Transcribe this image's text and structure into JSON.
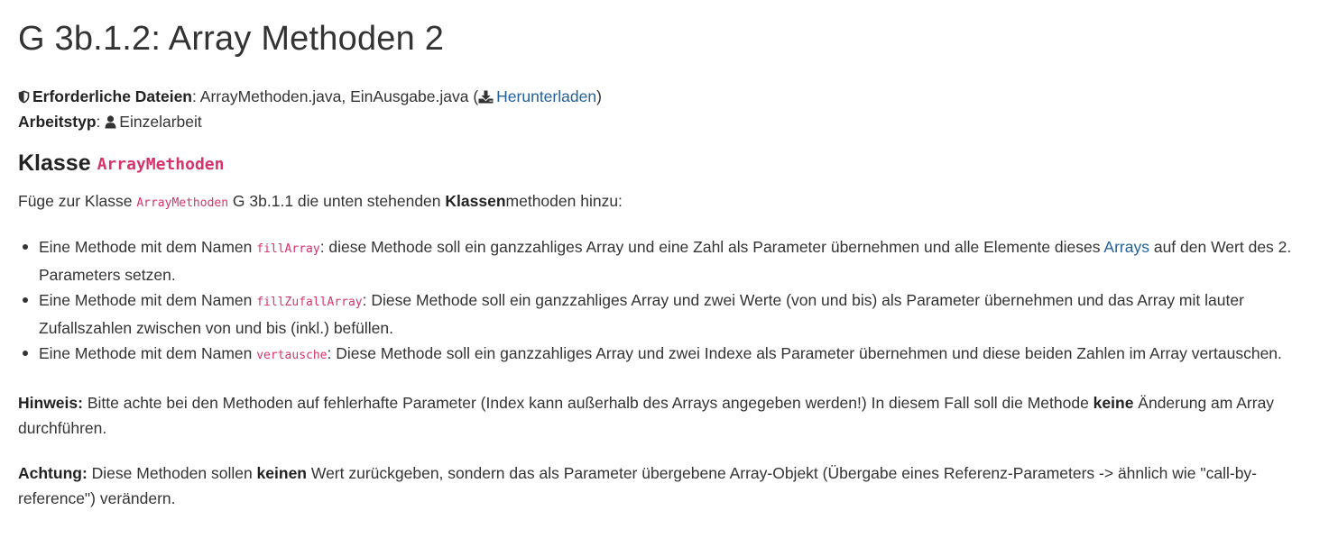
{
  "header": {
    "title": "G 3b.1.2: Array Methoden 2"
  },
  "meta": {
    "files_label": "Erforderliche Dateien",
    "files_colon": ":",
    "files_value": "ArrayMethoden.java, EinAusgabe.java (",
    "download_label": "Herunterladen",
    "files_close": ")",
    "type_label": "Arbeitstyp",
    "type_colon": ":",
    "type_value": "Einzelarbeit"
  },
  "section": {
    "heading": "Klasse",
    "class_name": "ArrayMethoden",
    "intro_before": "Füge zur Klasse ",
    "intro_code": "ArrayMethoden",
    "intro_middle": " G 3b.1.1 die unten stehenden ",
    "intro_bold": "Klassen",
    "intro_after": "methoden hinzu:"
  },
  "methods": [
    {
      "prefix": "Eine Methode mit dem Namen ",
      "name": "fillArray",
      "text_before_link": ": diese Methode soll ein ganzzahliges Array und eine Zahl als Parameter übernehmen und alle Elemente dieses ",
      "link": "Arrays",
      "text_after_link": " auf den Wert des 2. Parameters setzen."
    },
    {
      "prefix": "Eine Methode mit dem Namen ",
      "name": "fillZufallArray",
      "text": ": Diese Methode soll ein ganzzahliges Array und zwei Werte (von und bis) als Parameter übernehmen und das Array mit lauter Zufallszahlen zwischen von und bis (inkl.) befüllen."
    },
    {
      "prefix": "Eine Methode mit dem Namen ",
      "name": "vertausche",
      "text": ": Diese Methode soll ein ganzzahliges Array und zwei Indexe als Parameter übernehmen und diese beiden Zahlen im Array vertauschen."
    }
  ],
  "hint": {
    "label": "Hinweis:",
    "text_before": " Bitte achte bei den Methoden auf fehlerhafte Parameter (Index kann außerhalb des Arrays angegeben werden!) In diesem Fall soll die Methode ",
    "bold": "keine",
    "text_after": " Änderung am Array durchführen."
  },
  "warning": {
    "label": "Achtung:",
    "text_before": " Diese Methoden sollen ",
    "bold": "keinen",
    "text_after": " Wert zurückgeben, sondern das als Parameter übergebene Array-Objekt (Übergabe eines Referenz-Parameters -> ähnlich wie \"call-by-reference\") verändern."
  },
  "colors": {
    "text": "#333333",
    "link": "#23609b",
    "code": "#d6336c"
  },
  "icons": {
    "files": "shield-icon",
    "download": "download-icon",
    "type": "user-icon"
  }
}
